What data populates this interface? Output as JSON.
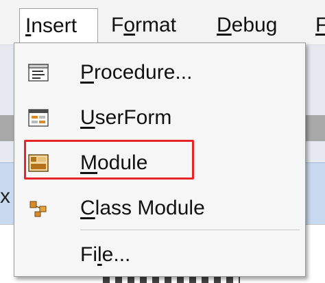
{
  "menubar": {
    "insert": {
      "pre": "",
      "ul": "I",
      "post": "nsert"
    },
    "format": {
      "pre": "F",
      "ul": "o",
      "post": "rmat"
    },
    "debug": {
      "pre": "",
      "ul": "D",
      "post": "ebug"
    },
    "clipped": {
      "pre": "",
      "ul": "F",
      "post": ""
    }
  },
  "menu": {
    "items": [
      {
        "pre": "",
        "ul": "P",
        "post": "rocedure...",
        "icon": "procedure-icon"
      },
      {
        "pre": "",
        "ul": "U",
        "post": "serForm",
        "icon": "userform-icon"
      },
      {
        "pre": "",
        "ul": "M",
        "post": "odule",
        "icon": "module-icon"
      },
      {
        "pre": "",
        "ul": "C",
        "post": "lass Module",
        "icon": "class-module-icon"
      },
      {
        "pre": "Fi",
        "ul": "l",
        "post": "e...",
        "icon": ""
      }
    ],
    "highlighted_item": "Module",
    "highlight_color": "#e8232a"
  },
  "background": {
    "edge_char": "x"
  }
}
